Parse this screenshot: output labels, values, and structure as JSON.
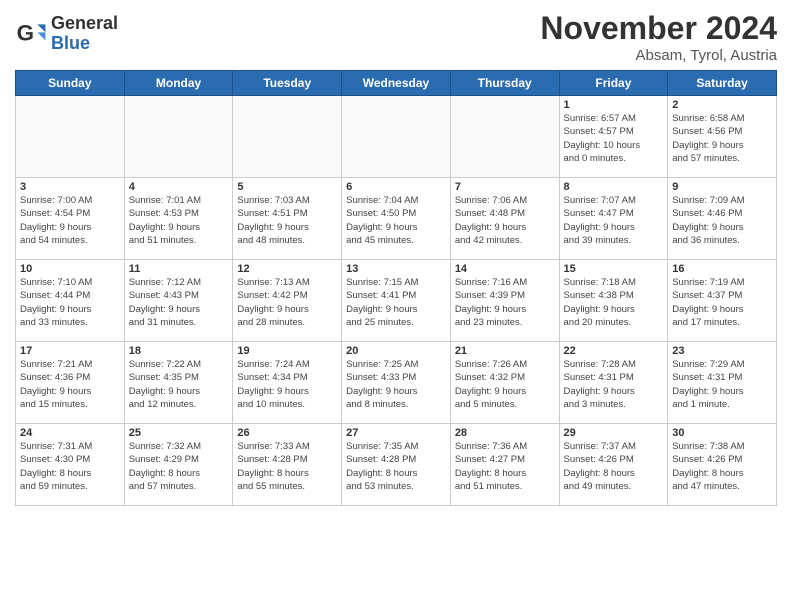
{
  "logo": {
    "general": "General",
    "blue": "Blue"
  },
  "header": {
    "title": "November 2024",
    "location": "Absam, Tyrol, Austria"
  },
  "weekdays": [
    "Sunday",
    "Monday",
    "Tuesday",
    "Wednesday",
    "Thursday",
    "Friday",
    "Saturday"
  ],
  "weeks": [
    [
      {
        "day": "",
        "info": ""
      },
      {
        "day": "",
        "info": ""
      },
      {
        "day": "",
        "info": ""
      },
      {
        "day": "",
        "info": ""
      },
      {
        "day": "",
        "info": ""
      },
      {
        "day": "1",
        "info": "Sunrise: 6:57 AM\nSunset: 4:57 PM\nDaylight: 10 hours\nand 0 minutes."
      },
      {
        "day": "2",
        "info": "Sunrise: 6:58 AM\nSunset: 4:56 PM\nDaylight: 9 hours\nand 57 minutes."
      }
    ],
    [
      {
        "day": "3",
        "info": "Sunrise: 7:00 AM\nSunset: 4:54 PM\nDaylight: 9 hours\nand 54 minutes."
      },
      {
        "day": "4",
        "info": "Sunrise: 7:01 AM\nSunset: 4:53 PM\nDaylight: 9 hours\nand 51 minutes."
      },
      {
        "day": "5",
        "info": "Sunrise: 7:03 AM\nSunset: 4:51 PM\nDaylight: 9 hours\nand 48 minutes."
      },
      {
        "day": "6",
        "info": "Sunrise: 7:04 AM\nSunset: 4:50 PM\nDaylight: 9 hours\nand 45 minutes."
      },
      {
        "day": "7",
        "info": "Sunrise: 7:06 AM\nSunset: 4:48 PM\nDaylight: 9 hours\nand 42 minutes."
      },
      {
        "day": "8",
        "info": "Sunrise: 7:07 AM\nSunset: 4:47 PM\nDaylight: 9 hours\nand 39 minutes."
      },
      {
        "day": "9",
        "info": "Sunrise: 7:09 AM\nSunset: 4:46 PM\nDaylight: 9 hours\nand 36 minutes."
      }
    ],
    [
      {
        "day": "10",
        "info": "Sunrise: 7:10 AM\nSunset: 4:44 PM\nDaylight: 9 hours\nand 33 minutes."
      },
      {
        "day": "11",
        "info": "Sunrise: 7:12 AM\nSunset: 4:43 PM\nDaylight: 9 hours\nand 31 minutes."
      },
      {
        "day": "12",
        "info": "Sunrise: 7:13 AM\nSunset: 4:42 PM\nDaylight: 9 hours\nand 28 minutes."
      },
      {
        "day": "13",
        "info": "Sunrise: 7:15 AM\nSunset: 4:41 PM\nDaylight: 9 hours\nand 25 minutes."
      },
      {
        "day": "14",
        "info": "Sunrise: 7:16 AM\nSunset: 4:39 PM\nDaylight: 9 hours\nand 23 minutes."
      },
      {
        "day": "15",
        "info": "Sunrise: 7:18 AM\nSunset: 4:38 PM\nDaylight: 9 hours\nand 20 minutes."
      },
      {
        "day": "16",
        "info": "Sunrise: 7:19 AM\nSunset: 4:37 PM\nDaylight: 9 hours\nand 17 minutes."
      }
    ],
    [
      {
        "day": "17",
        "info": "Sunrise: 7:21 AM\nSunset: 4:36 PM\nDaylight: 9 hours\nand 15 minutes."
      },
      {
        "day": "18",
        "info": "Sunrise: 7:22 AM\nSunset: 4:35 PM\nDaylight: 9 hours\nand 12 minutes."
      },
      {
        "day": "19",
        "info": "Sunrise: 7:24 AM\nSunset: 4:34 PM\nDaylight: 9 hours\nand 10 minutes."
      },
      {
        "day": "20",
        "info": "Sunrise: 7:25 AM\nSunset: 4:33 PM\nDaylight: 9 hours\nand 8 minutes."
      },
      {
        "day": "21",
        "info": "Sunrise: 7:26 AM\nSunset: 4:32 PM\nDaylight: 9 hours\nand 5 minutes."
      },
      {
        "day": "22",
        "info": "Sunrise: 7:28 AM\nSunset: 4:31 PM\nDaylight: 9 hours\nand 3 minutes."
      },
      {
        "day": "23",
        "info": "Sunrise: 7:29 AM\nSunset: 4:31 PM\nDaylight: 9 hours\nand 1 minute."
      }
    ],
    [
      {
        "day": "24",
        "info": "Sunrise: 7:31 AM\nSunset: 4:30 PM\nDaylight: 8 hours\nand 59 minutes."
      },
      {
        "day": "25",
        "info": "Sunrise: 7:32 AM\nSunset: 4:29 PM\nDaylight: 8 hours\nand 57 minutes."
      },
      {
        "day": "26",
        "info": "Sunrise: 7:33 AM\nSunset: 4:28 PM\nDaylight: 8 hours\nand 55 minutes."
      },
      {
        "day": "27",
        "info": "Sunrise: 7:35 AM\nSunset: 4:28 PM\nDaylight: 8 hours\nand 53 minutes."
      },
      {
        "day": "28",
        "info": "Sunrise: 7:36 AM\nSunset: 4:27 PM\nDaylight: 8 hours\nand 51 minutes."
      },
      {
        "day": "29",
        "info": "Sunrise: 7:37 AM\nSunset: 4:26 PM\nDaylight: 8 hours\nand 49 minutes."
      },
      {
        "day": "30",
        "info": "Sunrise: 7:38 AM\nSunset: 4:26 PM\nDaylight: 8 hours\nand 47 minutes."
      }
    ]
  ]
}
